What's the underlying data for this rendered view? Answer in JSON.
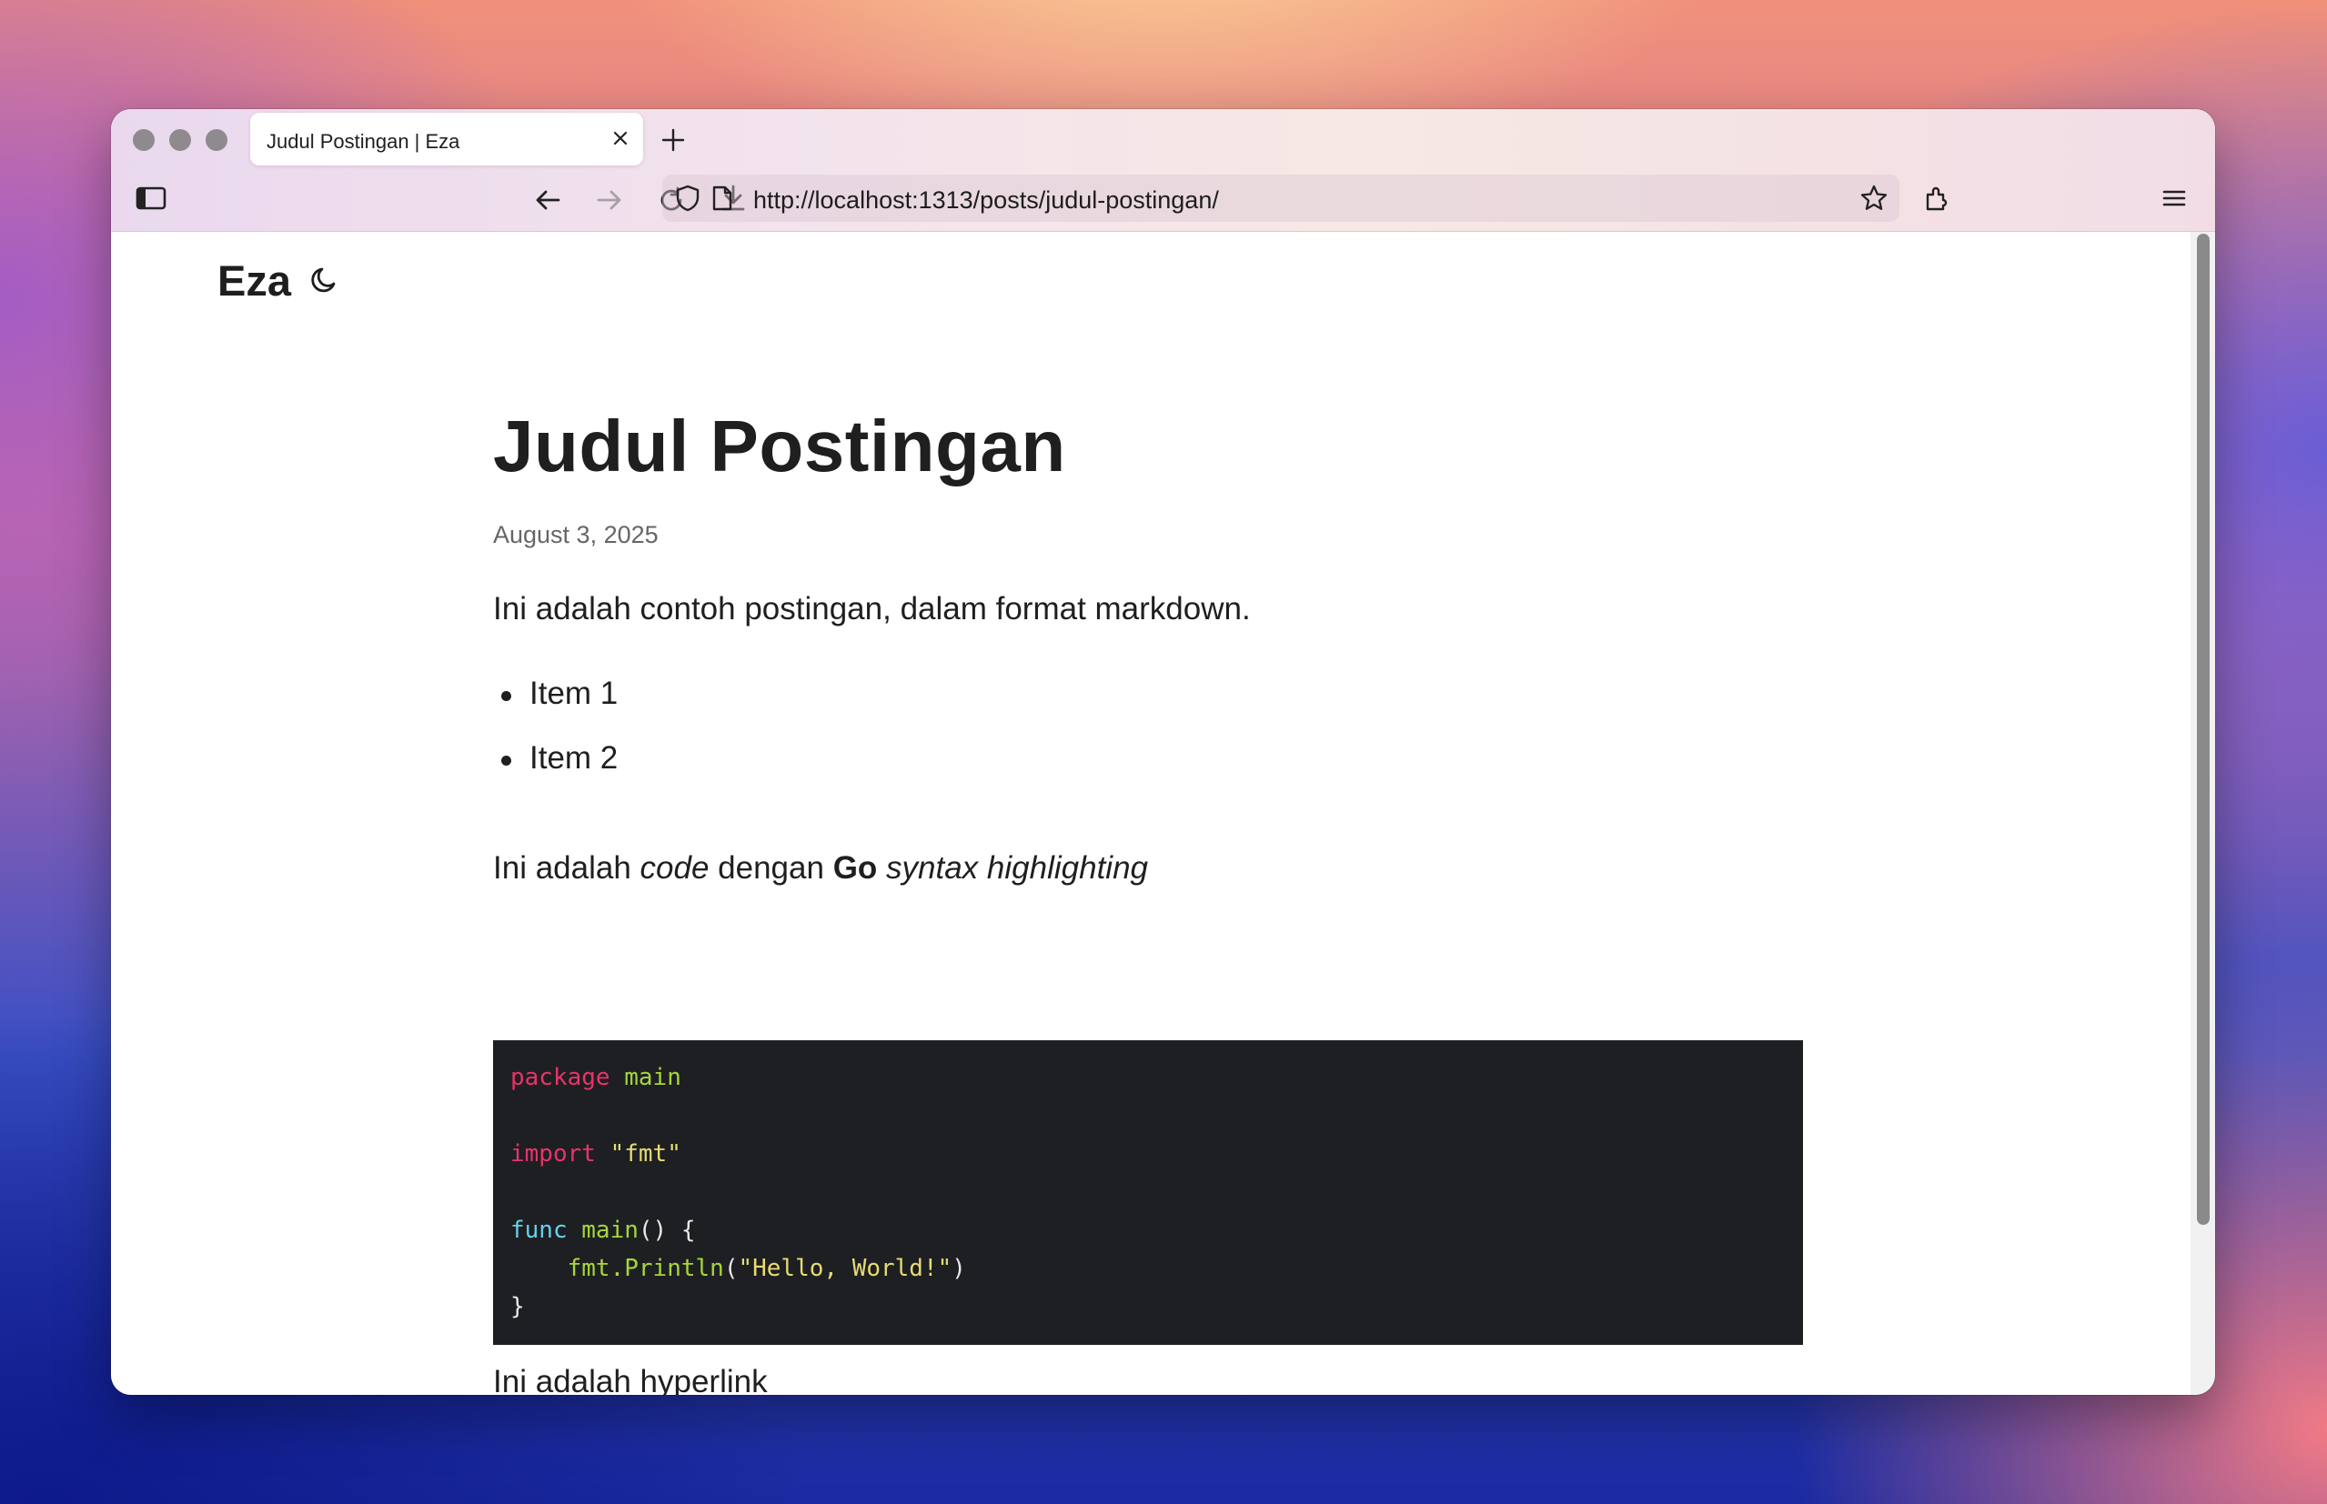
{
  "browser": {
    "tab_title": "Judul Postingan | Eza",
    "url": "http://localhost:1313/posts/judul-postingan/"
  },
  "site": {
    "title": "Eza"
  },
  "post": {
    "title": "Judul Postingan",
    "date": "August 3, 2025",
    "intro": "Ini adalah contoh postingan, dalam format markdown.",
    "list_items": [
      "Item 1",
      "Item 2"
    ],
    "code_sentence": {
      "p1": "Ini adalah ",
      "code_word": "code",
      "p2": " dengan ",
      "go_word": "Go",
      "p3": " ",
      "syntax_words": "syntax highlighting"
    },
    "code": {
      "line1_kw": "package",
      "line1_name": "main",
      "line2_kw": "import",
      "line2_str": "\"fmt\"",
      "line3_kw": "func",
      "line3_fn": "main",
      "line3_rest": "() {",
      "line4_indent": "    ",
      "line4_fn": "fmt.Println",
      "line4_open": "(",
      "line4_str": "\"Hello, World!\"",
      "line4_close": ")",
      "line5": "}"
    },
    "link_sentence": {
      "prefix": "Ini adalah ",
      "link_text": "hyperlink"
    }
  },
  "colors": {
    "keyword": "#e8336b",
    "function": "#a6d63a",
    "string": "#e6db74",
    "func_keyword": "#66d2e8",
    "code_background": "#1e1f22"
  }
}
